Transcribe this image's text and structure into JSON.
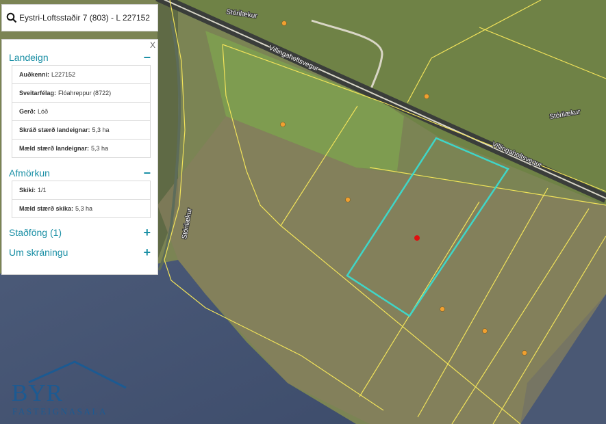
{
  "search": {
    "value": "Eystri-Loftsstaðir 7  (803) - L 227152"
  },
  "panel": {
    "close_label": "X",
    "sections": [
      {
        "title": "Landeign",
        "toggle": "−",
        "rows": [
          {
            "key": "Auðkenni:",
            "value": "L227152"
          },
          {
            "key": "Sveitarfélag:",
            "value": "Flóahreppur (8722)"
          },
          {
            "key": "Gerð:",
            "value": "Lóð"
          },
          {
            "key": "Skráð stærð landeignar:",
            "value": "5,3 ha"
          },
          {
            "key": "Mæld stærð landeignar:",
            "value": "5,3 ha"
          }
        ]
      },
      {
        "title": "Afmörkun",
        "toggle": "−",
        "rows": [
          {
            "key": "Skiki:",
            "value": "1/1"
          },
          {
            "key": "Mæld stærð skika:",
            "value": "5,3 ha"
          }
        ]
      },
      {
        "title": "Staðföng (1)",
        "toggle": "+"
      },
      {
        "title": "Um skráningu",
        "toggle": "+"
      }
    ]
  },
  "map": {
    "road_labels": [
      "Villingaholtsvegur",
      "Villingaholtsvegur"
    ],
    "stream_labels": [
      "Stórilækur",
      "Stórilækur",
      "Stórilækur"
    ],
    "colors": {
      "parcel_outline": "#f2e35a",
      "selected_parcel": "#3fd6c8",
      "address_dot": "#f0a030",
      "selected_dot": "#e01010"
    }
  },
  "logo": {
    "main": "BYR",
    "sub": "FASTEIGNASALA"
  }
}
